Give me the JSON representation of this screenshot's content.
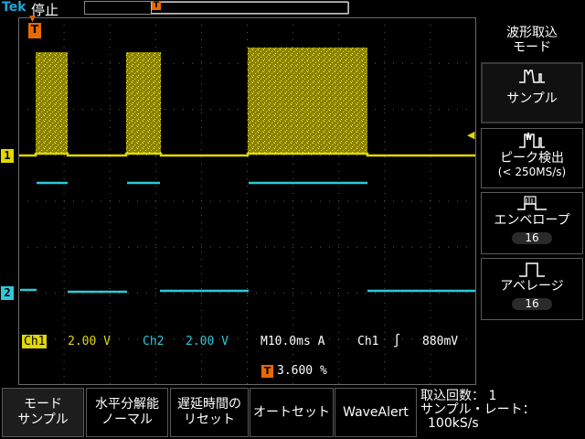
{
  "status": {
    "brand": "Tek",
    "run_state": "停止"
  },
  "markers": {
    "trigger": "T",
    "ch1": "1",
    "ch2": "2"
  },
  "readout": {
    "ch1_label": "Ch1",
    "ch1_scale": "2.00 V",
    "ch2_label": "Ch2",
    "ch2_scale": "2.00 V",
    "timebase": "M10.0ms A",
    "trigger_source": "Ch1",
    "trigger_slope": "∫",
    "trigger_level": "880mV",
    "trigger_position": "3.600 %"
  },
  "side_menu": {
    "title": "波形取込\nモード",
    "items": [
      {
        "label": "サンプル",
        "sub": "",
        "badge": "",
        "icon": "sample-mode-icon"
      },
      {
        "label": "ピーク検出",
        "sub": "(< 250MS/s)",
        "badge": "",
        "icon": "peak-detect-icon"
      },
      {
        "label": "エンベロープ",
        "sub": "",
        "badge": "16",
        "icon": "envelope-icon"
      },
      {
        "label": "アベレージ",
        "sub": "",
        "badge": "16",
        "icon": "average-icon"
      }
    ]
  },
  "bottom_menu": {
    "mode": {
      "title": "モード",
      "value": "サンプル"
    },
    "hres": {
      "title": "水平分解能",
      "value": "ノーマル"
    },
    "delay": {
      "title": "遅延時間の",
      "value": "リセット"
    },
    "autoset": "オートセット",
    "wavealert": "WaveAlert"
  },
  "acquisition": {
    "count_label": "取込回数：",
    "count_value": "1",
    "rate_label": "サンプル・レート：",
    "rate_value": "100kS/s"
  },
  "colors": {
    "ch1": "#e0d800",
    "ch2": "#2fc8d8",
    "trigger": "#e86a00",
    "grid": "#6a6a6a"
  }
}
